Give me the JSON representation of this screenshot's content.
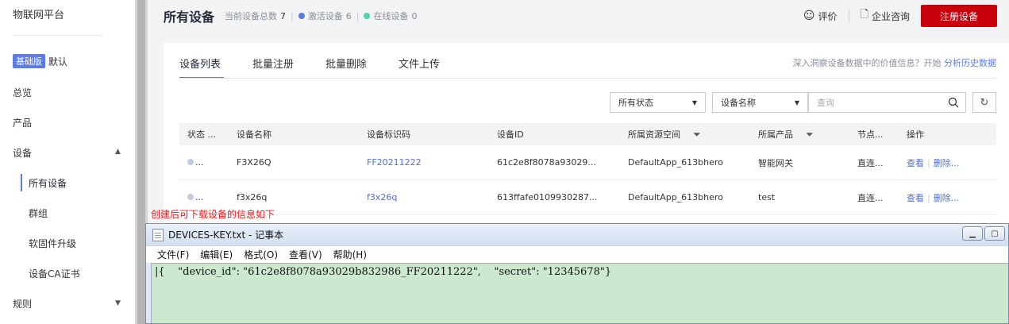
{
  "sidebar": {
    "platform_title": "物联网平台",
    "edition_badge": "基础版",
    "edition_name": "默认",
    "items": {
      "overview": "总览",
      "products": "产品",
      "devices": "设备",
      "all_devices": "所有设备",
      "groups": "群组",
      "firmware": "软固件升级",
      "ca_cert": "设备CA证书",
      "rules": "规则"
    }
  },
  "header": {
    "title": "所有设备",
    "total_label": "当前设备总数",
    "total_value": "7",
    "active_label": "激活设备",
    "active_value": "6",
    "online_label": "在线设备",
    "online_value": "0",
    "rate_label": "评价",
    "consult_label": "企业咨询",
    "register_label": "注册设备"
  },
  "tabs": [
    "设备列表",
    "批量注册",
    "批量删除",
    "文件上传"
  ],
  "insight": {
    "text": "深入洞察设备数据中的价值信息？开始",
    "link": "分析历史数据"
  },
  "filters": {
    "status_select": "所有状态",
    "field_select": "设备名称",
    "search_placeholder": "查询"
  },
  "table": {
    "headers": [
      "状态 ...",
      "设备名称",
      "设备标识码",
      "设备ID",
      "所属资源空间",
      "所属产品",
      "节点...",
      "操作"
    ],
    "rows": [
      {
        "status": "...",
        "name": "F3X26Q",
        "code": "FF20211222",
        "id": "61c2e8f8078a93029...",
        "space": "DefaultApp_613bhero",
        "product": "智能网关",
        "node": "直连...",
        "view": "查看",
        "delete": "删除..."
      },
      {
        "status": "...",
        "name": "f3x26q",
        "code": "f3x26q",
        "id": "613ffafe0109930287...",
        "space": "DefaultApp_613bhero",
        "product": "test",
        "node": "直连...",
        "view": "查看",
        "delete": "删除..."
      }
    ]
  },
  "annotation": "创建后可下载设备的信息如下",
  "notepad": {
    "title": "DEVICES-KEY.txt - 记事本",
    "menu": [
      "文件(F)",
      "编辑(E)",
      "格式(O)",
      "查看(V)",
      "帮助(H)"
    ],
    "content": "|{    \"device_id\": \"61c2e8f8078a93029b832986_FF20211222\",    \"secret\": \"12345678\"}"
  },
  "colors": {
    "accent": "#5e7ce0",
    "register_button": "#c7000b",
    "annotation": "#e02020",
    "notepad_editor_bg": "#cce8cf",
    "active_dot": "#5e7ce0",
    "online_dot": "#50d4ab"
  }
}
